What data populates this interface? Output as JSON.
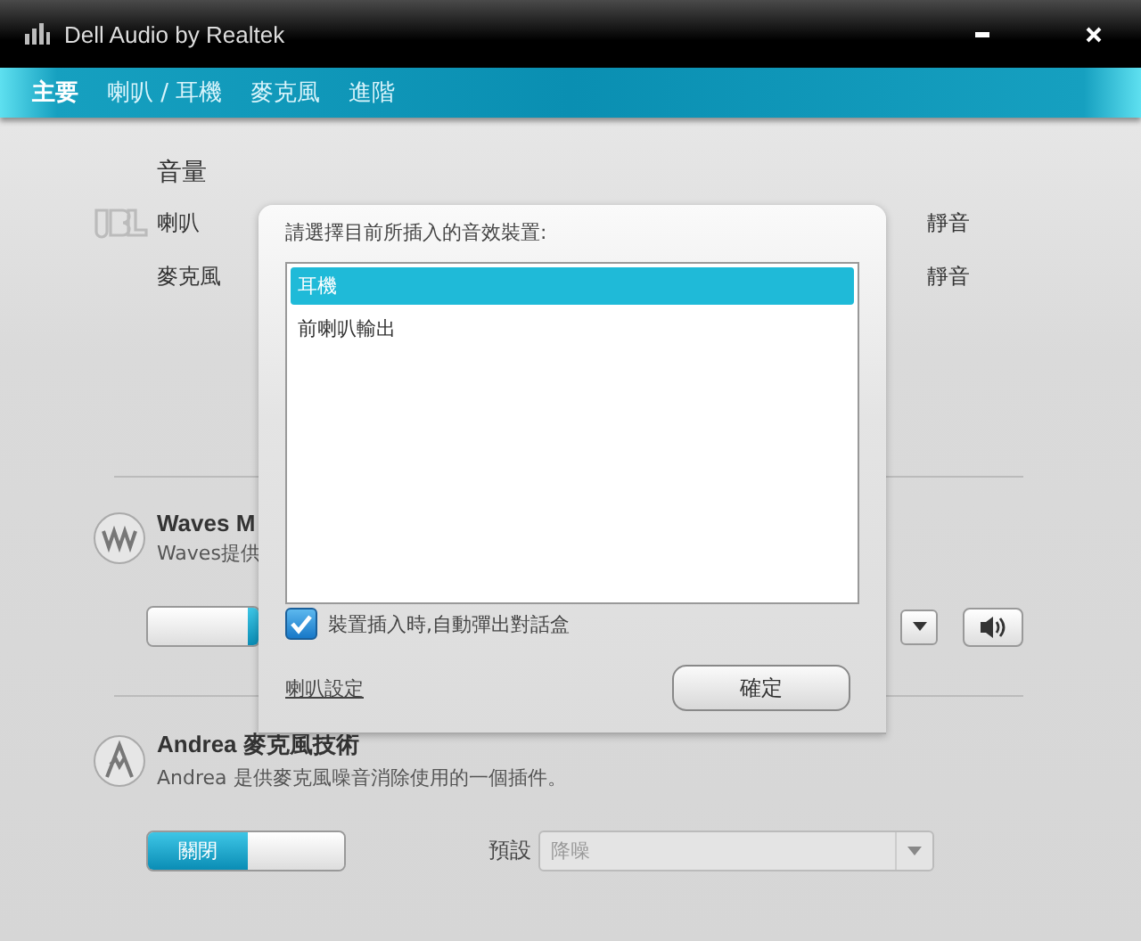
{
  "window": {
    "title": "Dell Audio by Realtek"
  },
  "tabs": [
    {
      "label": "主要",
      "selected": true
    },
    {
      "label": "喇叭 / 耳機",
      "selected": false
    },
    {
      "label": "麥克風",
      "selected": false
    },
    {
      "label": "進階",
      "selected": false
    }
  ],
  "volume": {
    "title": "音量",
    "rows": [
      {
        "label": "喇叭",
        "mute_label": "靜音"
      },
      {
        "label": "麥克風",
        "mute_label": "靜音"
      }
    ]
  },
  "waves": {
    "title": "Waves M",
    "description": "Waves提供",
    "toggle": {
      "on": true
    }
  },
  "andrea": {
    "title": "Andrea 麥克風技術",
    "description": "Andrea 是供麥克風噪音消除使用的一個插件。",
    "toggle": {
      "on": false,
      "label": "關閉"
    },
    "preset": {
      "label": "預設",
      "value": "降噪",
      "disabled": true
    }
  },
  "dialog": {
    "prompt": "請選擇目前所插入的音效裝置:",
    "devices": [
      {
        "label": "耳機",
        "selected": true
      },
      {
        "label": "前喇叭輸出",
        "selected": false
      }
    ],
    "auto_popup": {
      "label": "裝置插入時,自動彈出對話盒",
      "checked": true
    },
    "link": "喇叭設定",
    "ok_button": "確定"
  }
}
